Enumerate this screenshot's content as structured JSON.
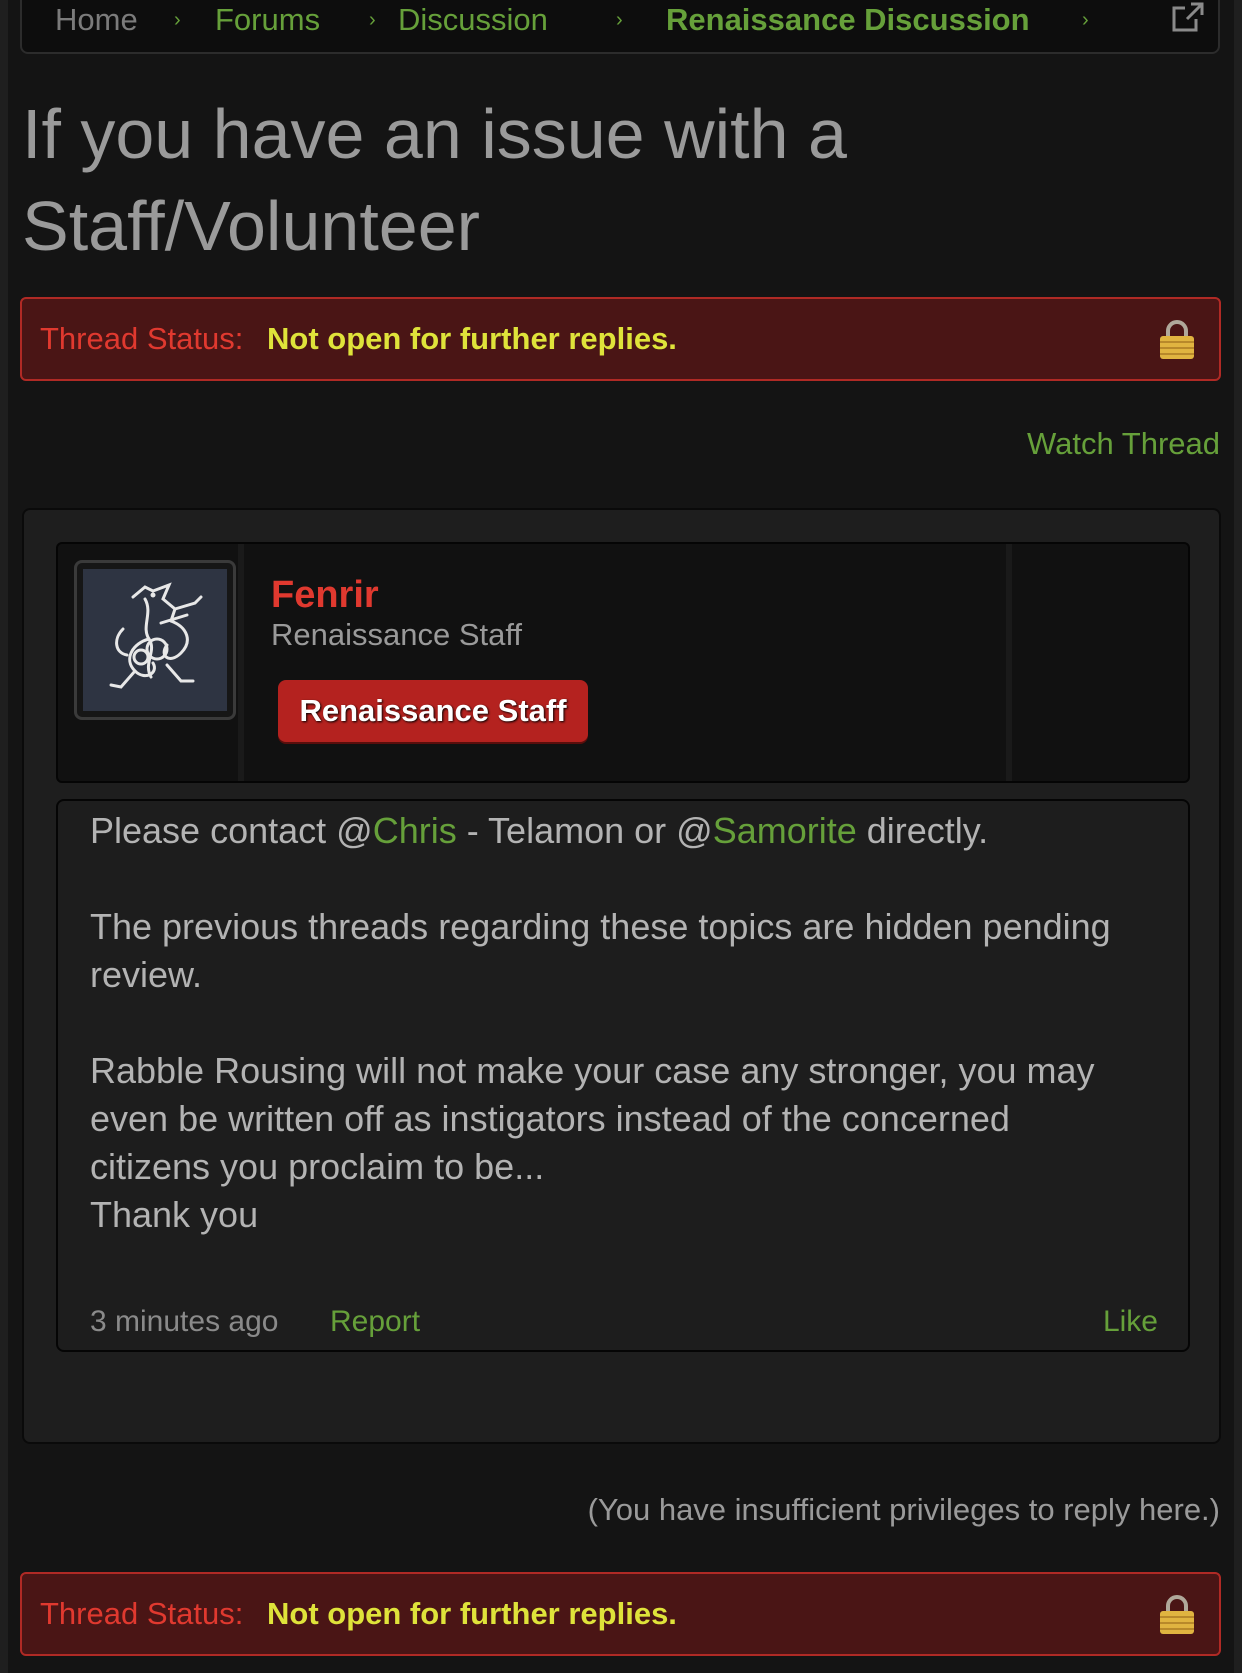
{
  "breadcrumb": {
    "items": [
      {
        "label": "Home"
      },
      {
        "label": "Forums"
      },
      {
        "label": "Discussion"
      },
      {
        "label": "Renaissance Discussion"
      }
    ],
    "separator": "›",
    "external_icon": "external-link-icon"
  },
  "thread": {
    "title": "If you have an issue with a Staff/Volunteer",
    "status_label": "Thread Status:",
    "status_value": "Not open for further replies.",
    "lock_icon": "lock-icon",
    "watch_label": "Watch Thread"
  },
  "post": {
    "author": {
      "name": "Fenrir",
      "title": "Renaissance Staff",
      "badge": "Renaissance Staff",
      "avatar_icon": "wolf-knot-avatar"
    },
    "message": {
      "p1_before": "Please contact @",
      "mention1": "Chris",
      "p1_middle": " - Telamon or @",
      "mention2": "Samorite",
      "p1_after": " directly.",
      "p2": "The previous threads regarding these topics are hidden pending review.",
      "p3": "Rabble Rousing will not make your case any stronger, you may even be written off as instigators instead of the concerned citizens you proclaim to be...",
      "p4": "Thank you"
    },
    "time": "3 minutes ago",
    "report_label": "Report",
    "like_label": "Like"
  },
  "reply_note": "(You have insufficient privileges to reply here.)",
  "colors": {
    "background": "#141414",
    "link_green": "#66a03a",
    "status_red": "#e0392f",
    "status_yellow": "#dfe33a",
    "status_bg": "#4a1515",
    "badge_red": "#b4221f"
  }
}
